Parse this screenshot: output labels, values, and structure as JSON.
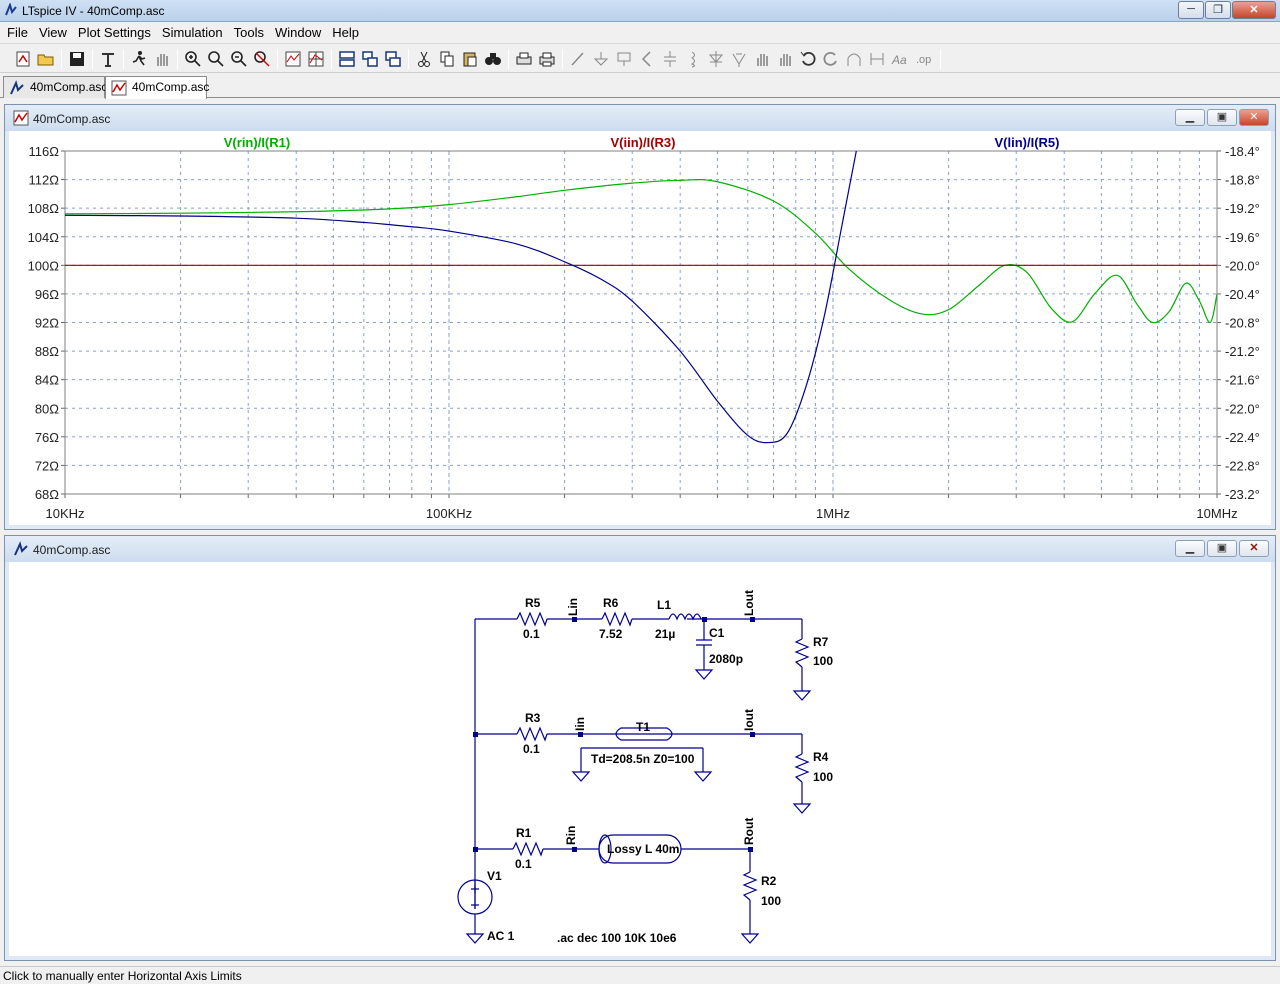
{
  "window": {
    "title": "LTspice IV - 40mComp.asc",
    "min": "─",
    "max": "❐",
    "close": "✕"
  },
  "menu": [
    "File",
    "View",
    "Plot Settings",
    "Simulation",
    "Tools",
    "Window",
    "Help"
  ],
  "toolbar_icons": [
    "new-schematic",
    "open",
    "save",
    "control-panel",
    "run",
    "halt",
    "zoom-in",
    "zoom-area",
    "zoom-out",
    "zoom-fit",
    "autorange",
    "grid",
    "tile-horizontal",
    "tile-vertical",
    "cascade",
    "cut",
    "copy",
    "paste",
    "find",
    "print-setup",
    "print",
    "wire",
    "ground",
    "label-net",
    "component",
    "resistor",
    "capacitor",
    "inductor",
    "diode",
    "move",
    "drag",
    "undo",
    "redo",
    "rotate",
    "mirror",
    "text",
    "spice-directive"
  ],
  "tabs": [
    {
      "label": "40mComp.asc",
      "icon": "schematic-icon",
      "active": false
    },
    {
      "label": "40mComp.asc",
      "icon": "waveform-icon",
      "active": true
    }
  ],
  "plot_window": {
    "title": "40mComp.asc",
    "traces": [
      {
        "label": "V(rin)/I(R1)",
        "color": "#00b000"
      },
      {
        "label": "V(iin)/I(R3)",
        "color": "#a00000"
      },
      {
        "label": "V(lin)/I(R5)",
        "color": "#00008c"
      }
    ],
    "y_left_ticks": [
      "116Ω",
      "112Ω",
      "108Ω",
      "104Ω",
      "100Ω",
      "96Ω",
      "92Ω",
      "88Ω",
      "84Ω",
      "80Ω",
      "76Ω",
      "72Ω",
      "68Ω"
    ],
    "y_right_ticks": [
      "-18.4°",
      "-18.8°",
      "-19.2°",
      "-19.6°",
      "-20.0°",
      "-20.4°",
      "-20.8°",
      "-21.2°",
      "-21.6°",
      "-22.0°",
      "-22.4°",
      "-22.8°",
      "-23.2°"
    ],
    "x_ticks": [
      "10KHz",
      "100KHz",
      "1MHz",
      "10MHz"
    ],
    "ylim": [
      68,
      116
    ],
    "xlim": [
      10000,
      10000000
    ]
  },
  "chart_data": {
    "type": "line",
    "title": "",
    "xlabel": "",
    "ylabel": "",
    "x_scale": "log",
    "xlim": [
      10000,
      10000000
    ],
    "ylim": [
      68,
      116
    ],
    "y2lim": [
      -23.2,
      -18.4
    ],
    "series": [
      {
        "name": "V(rin)/I(R1)",
        "x": [
          10000,
          20000,
          40000,
          70000,
          100000,
          150000,
          200000,
          300000,
          400000,
          500000,
          700000,
          900000,
          1100000,
          1400000,
          1700000,
          2000000,
          2400000,
          2800000,
          3200000,
          3700000,
          4200000,
          4800000,
          5500000,
          6200000,
          6800000,
          7500000,
          8300000,
          9000000,
          9600000,
          10000000
        ],
        "values": [
          107.2,
          107.3,
          107.5,
          107.9,
          108.5,
          109.6,
          110.5,
          111.5,
          111.9,
          111.7,
          109.0,
          104.5,
          99.5,
          95.2,
          93.2,
          93.8,
          97.2,
          100.0,
          99.0,
          94.0,
          92.1,
          96.0,
          98.6,
          94.5,
          92.0,
          93.5,
          97.5,
          95.0,
          92.0,
          96.0
        ]
      },
      {
        "name": "V(iin)/I(R3)",
        "x": [
          10000,
          10000000
        ],
        "values": [
          100,
          100
        ]
      },
      {
        "name": "V(lin)/I(R5)",
        "x": [
          10000,
          20000,
          40000,
          60000,
          80000,
          100000,
          150000,
          200000,
          250000,
          300000,
          400000,
          500000,
          600000,
          680000,
          760000,
          850000,
          950000,
          1050000,
          1150000
        ],
        "values": [
          107.0,
          106.9,
          106.6,
          106.0,
          105.4,
          104.8,
          103.0,
          100.5,
          98.0,
          95.0,
          88.0,
          81.0,
          76.2,
          75.2,
          76.5,
          83.0,
          93.0,
          105.0,
          116.0
        ]
      }
    ]
  },
  "schematic_window": {
    "title": "40mComp.asc",
    "labels": {
      "R5": "R5",
      "R5v": "0.1",
      "Lin": "Lin",
      "R6": "R6",
      "R6v": "7.52",
      "L1": "L1",
      "L1v": "21µ",
      "C1": "C1",
      "C1v": "2080p",
      "Lout": "Lout",
      "R7": "R7",
      "R7v": "100",
      "R3": "R3",
      "R3v": "0.1",
      "Iin": "Iin",
      "T1": "T1",
      "T1v": "Td=208.5n Z0=100",
      "Iout": "Iout",
      "R4": "R4",
      "R4v": "100",
      "R1": "R1",
      "R1v": "0.1",
      "Rin": "Rin",
      "LT": "Lossy L 40m",
      "Rout": "Rout",
      "R2": "R2",
      "R2v": "100",
      "V1": "V1",
      "V1v": "AC 1",
      "directive": ".ac dec 100 10K 10e6"
    }
  },
  "status": "Click to manually enter Horizontal Axis Limits"
}
